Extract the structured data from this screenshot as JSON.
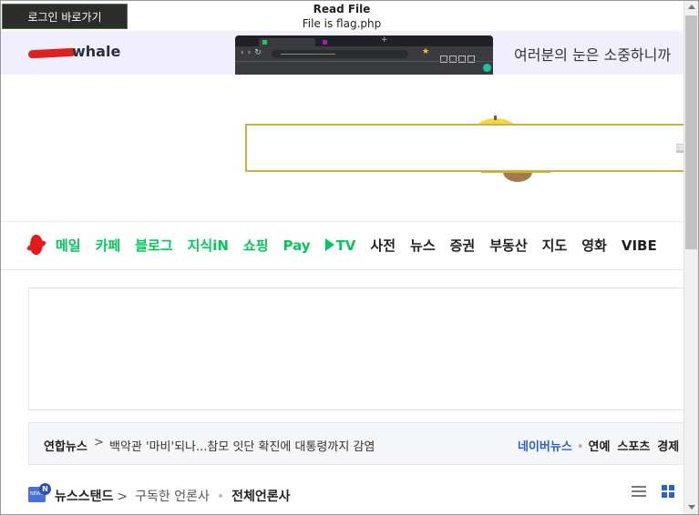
{
  "header": {
    "login_button": "로그인 바로가기",
    "dialog_title": "Read File",
    "dialog_subtitle": "File is flag.php"
  },
  "banner": {
    "logo_text": "whale",
    "promo_text": "여러분의 눈은 소중하니까"
  },
  "search": {
    "icon": "search-icon",
    "icon_glyph": "⌨"
  },
  "services": {
    "items": [
      {
        "label": "메일",
        "color": "#03c75a"
      },
      {
        "label": "카페",
        "color": "#03c75a"
      },
      {
        "label": "블로그",
        "color": "#03c75a"
      },
      {
        "label": "지식iN",
        "color": "#03c75a"
      },
      {
        "label": "쇼핑",
        "color": "#03c75a"
      },
      {
        "label": "Pay",
        "color": "#03c75a"
      },
      {
        "label": "TV",
        "color": "#03c75a"
      },
      {
        "label": "사전",
        "color": "#222222"
      },
      {
        "label": "뉴스",
        "color": "#222222"
      },
      {
        "label": "증권",
        "color": "#222222"
      },
      {
        "label": "부동산",
        "color": "#222222"
      },
      {
        "label": "지도",
        "color": "#222222"
      },
      {
        "label": "영화",
        "color": "#222222"
      },
      {
        "label": "VIBE",
        "color": "#222222"
      }
    ]
  },
  "news": {
    "source": "연합뉴스",
    "chevron": ">",
    "headline": "백악관 '마비'되나...참모 잇단 확진에 대통령까지 감염",
    "naver_news": "네이버뉴스",
    "separator": "•",
    "tabs": [
      "연예",
      "스포츠",
      "경제"
    ]
  },
  "newsstand": {
    "icon_text": "NEWS",
    "badge": "N",
    "title": "뉴스스탠드",
    "chevron": ">",
    "subscribed": "구독한 언론사",
    "separator": "•",
    "all": "전체언론사"
  },
  "colors": {
    "brand_green": "#03c75a",
    "banner_bg": "#f1effd",
    "search_border": "#d3ad41",
    "link_blue": "#2a60d2"
  }
}
